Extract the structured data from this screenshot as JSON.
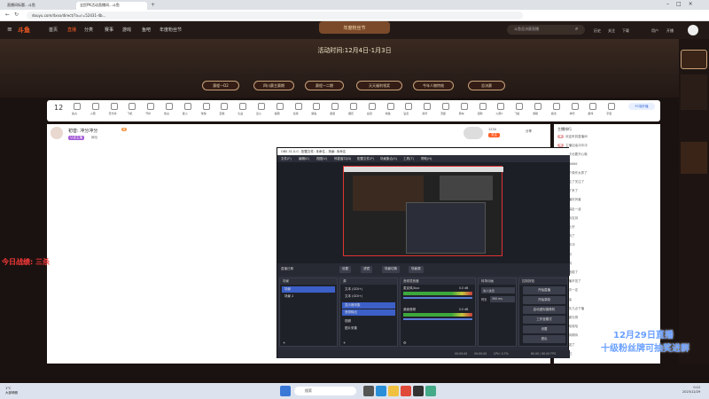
{
  "browser": {
    "tabs": [
      "直播间标题...斗鱼",
      "全民PK活动直播间...斗鱼"
    ],
    "url": "douyu.com/4xxx/direct/?a=r=52431-4b..."
  },
  "site": {
    "logo": "斗鱼",
    "nav": [
      "首页",
      "直播",
      "分类",
      "赛事",
      "游戏",
      "鱼吧",
      "年度粉丝节"
    ],
    "search_placeholder": "斗鱼总决赛直播",
    "header_icons": [
      "历史",
      "关注",
      "下载",
      "用户",
      "开播"
    ]
  },
  "banner": {
    "title": "年度粉丝节",
    "date": "活动时间:12月4日-1月3日",
    "pills": [
      "赛程一D2",
      "四川赛主赛期",
      "赛程一二期",
      "天天福利领奖",
      "今年人物特效",
      "总决赛"
    ]
  },
  "giftbar": {
    "count": "12",
    "items": [
      "鱼丸",
      "火箭",
      "荧光棒",
      "飞机",
      "守护",
      "告白",
      "星火",
      "玫瑰",
      "宝箱",
      "礼盒",
      "爱心",
      "超跑",
      "巡游",
      "鲸鱼",
      "星星",
      "烟花",
      "皇冠",
      "城堡",
      "钻石",
      "奖杯",
      "流星",
      "跑车",
      "招财",
      "火箭2",
      "飞船",
      "游艇",
      "魔法",
      "神兽",
      "星球",
      "宇宙"
    ],
    "right_label": "PC端开播"
  },
  "streamer": {
    "name": "初音: 冲分冲分",
    "level": "8",
    "tags": [
      "认证主播",
      "舞蹈"
    ],
    "follow_button": "关注",
    "follow_count": "1234",
    "share": "分享"
  },
  "chat": {
    "header": "主播排行",
    "lines": [
      "欢迎来到直播间",
      "主播加油冲冲冲",
      "今天也要开心哦",
      "666666",
      "这个操作太秀了",
      "关注了关注了",
      "来了来了",
      "主播好厉害",
      "弹幕走一波",
      "支持支持",
      "晚上好",
      "学到了",
      "冲冲冲",
      "好听",
      "签到",
      "这波稳了",
      "主播辛苦了",
      "下次一定",
      "加油",
      "今天几点下播",
      "感谢礼物",
      "哈哈哈哈",
      "期待期待",
      "太强了",
      "路过"
    ]
  },
  "obs": {
    "title": "OBS 31.0.0 - 配置文件: 未命名 - 场景: 未命名",
    "menu": [
      "文件(F)",
      "编辑(E)",
      "视图(V)",
      "停靠窗口(D)",
      "配置文件(P)",
      "场景集合(S)",
      "工具(T)",
      "帮助(H)"
    ],
    "source_tabs": [
      "设置",
      "滤镜",
      "场景切换",
      "场景源"
    ],
    "toolbar_label": "直播日期",
    "scenes_header": "场景",
    "scenes": [
      "场景",
      "场景 2"
    ],
    "sources_header": "源",
    "sources": [
      "文本 (GDI+)",
      "文本 (GDI+)",
      "显示器采集",
      "音频输出",
      "视频",
      "图片采集"
    ],
    "mixer_header": "音频混音器",
    "mixer": [
      {
        "name": "麦克风/Aux",
        "db": "0.0 dB"
      },
      {
        "name": "桌面音频",
        "db": "0.0 dB"
      }
    ],
    "transition_header": "转场动画",
    "transition_type": "淡入淡出",
    "transition_duration_label": "时长",
    "transition_duration": "300 ms",
    "controls_header": "控制按钮",
    "controls": [
      "开始直播",
      "开始录制",
      "启动虚拟摄像机",
      "工作室模式",
      "设置",
      "退出"
    ],
    "status": {
      "cpu": "CPU: 0.7%",
      "fps": "60.00 / 60.00 FPS",
      "time1": "00:00:00",
      "time2": "00:00:00"
    }
  },
  "overlays": {
    "left": "今日战绩: 三杀",
    "right_line1": "12月29日直播",
    "right_line2": "十级粉丝牌可抽奖进群"
  },
  "taskbar": {
    "weather_line1": "1°C",
    "weather_line2": "大部晴朗",
    "search": "搜索",
    "clock_time": "0:12",
    "clock_date": "2023/12/29"
  },
  "colors": {
    "accent": "#ff5d23",
    "obs_bg": "#2b2e38",
    "overlay_red": "#ff3a3a",
    "overlay_blue": "#6aa0ff"
  }
}
